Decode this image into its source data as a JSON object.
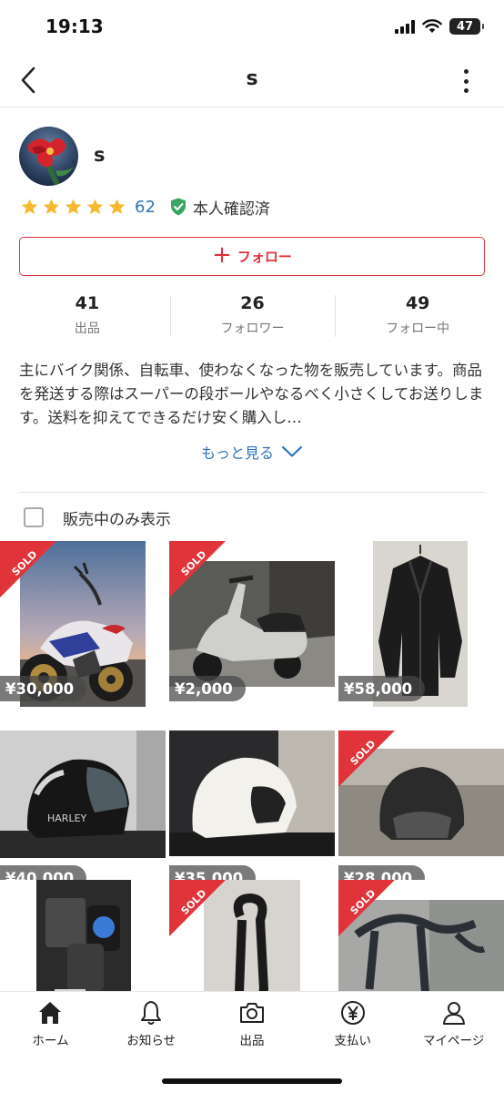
{
  "status_bar": {
    "time": "19:13",
    "battery": "47"
  },
  "header": {
    "title": "s"
  },
  "profile": {
    "name": "s",
    "rating_stars": 5,
    "rating_count": "62",
    "verified_label": "本人確認済"
  },
  "follow_button": {
    "label": "フォロー"
  },
  "stats": [
    {
      "value": "41",
      "label": "出品"
    },
    {
      "value": "26",
      "label": "フォロワー"
    },
    {
      "value": "49",
      "label": "フォロー中"
    }
  ],
  "bio": {
    "text": "主にバイク関係、自転車、使わなくなった物を販売しています。商品を発送する際はスーパーの段ボールやなるべく小さくしてお送りします。送料を抑えてできるだけ安く購入し…",
    "more_label": "もっと見る"
  },
  "filter": {
    "label": "販売中のみ表示",
    "checked": false
  },
  "items": [
    {
      "subject": "motorcycle",
      "sold": true,
      "sold_label": "SOLD",
      "price": "¥30,000"
    },
    {
      "subject": "scooter",
      "sold": true,
      "sold_label": "SOLD",
      "price": "¥2,000"
    },
    {
      "subject": "leather-jacket",
      "sold": false,
      "price": "¥58,000"
    },
    {
      "subject": "black-helmet",
      "sold": false,
      "price": "¥40,000"
    },
    {
      "subject": "white-helmet",
      "sold": false,
      "price": "¥35,000"
    },
    {
      "subject": "jet-helmet",
      "sold": true,
      "sold_label": "SOLD",
      "price": "¥28,000"
    },
    {
      "subject": "intercom",
      "sold": false,
      "price": ""
    },
    {
      "subject": "chain-lock",
      "sold": true,
      "sold_label": "SOLD",
      "price": ""
    },
    {
      "subject": "bike-stand",
      "sold": true,
      "sold_label": "SOLD",
      "price": ""
    }
  ],
  "tab_bar": [
    {
      "icon": "home-icon",
      "label": "ホーム"
    },
    {
      "icon": "bell-icon",
      "label": "お知らせ"
    },
    {
      "icon": "camera-icon",
      "label": "出品"
    },
    {
      "icon": "yen-icon",
      "label": "支払い"
    },
    {
      "icon": "person-icon",
      "label": "マイページ"
    }
  ],
  "colors": {
    "accent": "#e0333a",
    "link": "#2f73b8",
    "star": "#f5b82e",
    "verified": "#3aa564"
  }
}
